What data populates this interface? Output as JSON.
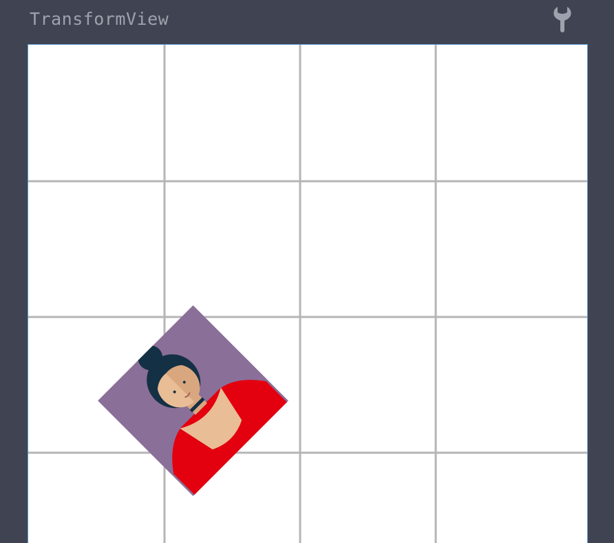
{
  "header": {
    "title": "TransformView",
    "settings_icon": "wrench-icon"
  },
  "canvas": {
    "background": "#ffffff",
    "grid_color": "#b5b5b5",
    "grid_columns": 4,
    "grid_rows": 4
  },
  "transformed_image": {
    "icon": "woman-avatar-icon",
    "rotation_degrees": 45,
    "background_color": "#8a6f98",
    "hair_color": "#143044",
    "skin_color": "#e9bd96",
    "dress_color": "#e3000f"
  }
}
